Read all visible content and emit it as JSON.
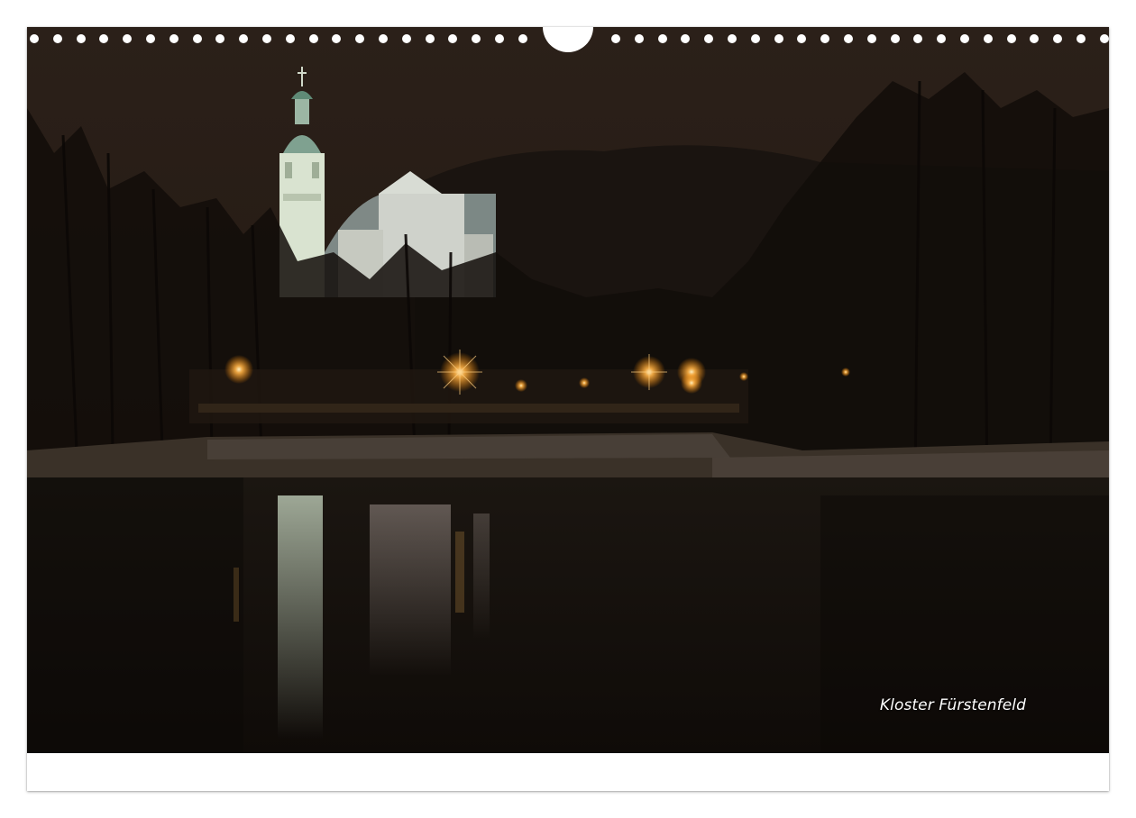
{
  "calendar": {
    "caption": "Kloster Fürstenfeld",
    "colors": {
      "sky": "#2a1f17",
      "water": "#15100c",
      "church_glow": "#dfe9d8",
      "lamp_glow": "#ffb347"
    },
    "icons": [
      "binding-hole-icon",
      "hanger-notch-icon"
    ]
  }
}
